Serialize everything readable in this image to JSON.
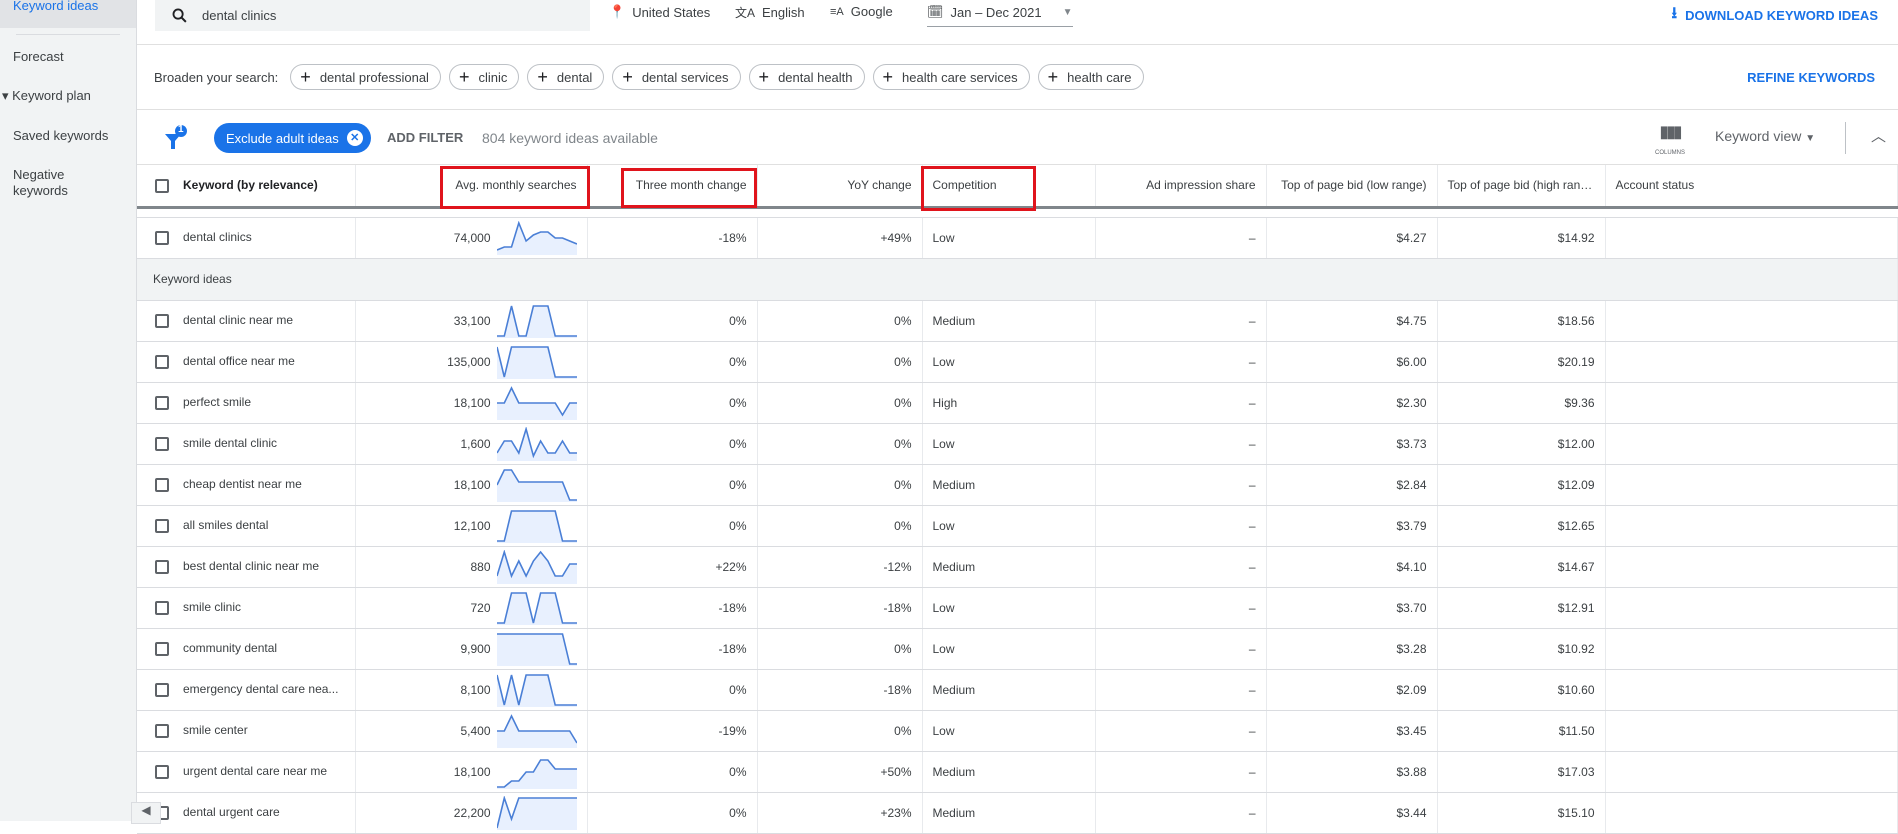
{
  "sidebar": {
    "items": [
      {
        "label": "Keyword ideas",
        "active": true
      },
      {
        "label": "Forecast"
      },
      {
        "label": "▾ Keyword plan"
      },
      {
        "label": "Saved keywords"
      },
      {
        "label": "Negative keywords"
      }
    ]
  },
  "topbar": {
    "search_value": "dental clinics",
    "location": "United States",
    "language": "English",
    "network": "Google",
    "date_range": "Jan – Dec 2021",
    "download_label": "DOWNLOAD KEYWORD IDEAS"
  },
  "broaden": {
    "label": "Broaden your search:",
    "chips": [
      "dental professional",
      "clinic",
      "dental",
      "dental services",
      "dental health",
      "health care services",
      "health care"
    ],
    "refine_label": "REFINE KEYWORDS"
  },
  "filters": {
    "badge_count": "1",
    "active_filter": "Exclude adult ideas",
    "add_filter_label": "ADD FILTER",
    "ideas_count": "804 keyword ideas available",
    "columns_label": "COLUMNS",
    "view_label": "Keyword view"
  },
  "table": {
    "columns": [
      "Keyword (by relevance)",
      "Avg. monthly searches",
      "Three month change",
      "YoY change",
      "Competition",
      "Ad impression share",
      "Top of page bid (low range)",
      "Top of page bid (high range)",
      "Account status"
    ],
    "highlight_color": "#e0141c",
    "sparkline_color": "#4a7fd6",
    "searched": [
      {
        "keyword": "dental clinics",
        "searches": "74,000",
        "three_month": "-18%",
        "yoy": "+49%",
        "competition": "Low",
        "impression": "–",
        "low_bid": "$4.27",
        "high_bid": "$14.92",
        "trend": [
          1,
          2,
          2,
          10,
          4,
          6,
          7,
          7,
          5,
          5,
          4,
          3
        ]
      }
    ],
    "group_label": "Keyword ideas",
    "rows": [
      {
        "keyword": "dental clinic near me",
        "searches": "33,100",
        "three_month": "0%",
        "yoy": "0%",
        "competition": "Medium",
        "impression": "–",
        "low_bid": "$4.75",
        "high_bid": "$18.56",
        "trend": [
          0,
          0,
          10,
          0,
          0,
          10,
          10,
          10,
          0,
          0,
          0,
          0
        ]
      },
      {
        "keyword": "dental office near me",
        "searches": "135,000",
        "three_month": "0%",
        "yoy": "0%",
        "competition": "Low",
        "impression": "–",
        "low_bid": "$6.00",
        "high_bid": "$20.19",
        "trend": [
          10,
          0,
          10,
          10,
          10,
          10,
          10,
          10,
          0,
          0,
          0,
          0
        ]
      },
      {
        "keyword": "perfect smile",
        "searches": "18,100",
        "three_month": "0%",
        "yoy": "0%",
        "competition": "High",
        "impression": "–",
        "low_bid": "$2.30",
        "high_bid": "$9.36",
        "trend": [
          5,
          5,
          10,
          5,
          5,
          5,
          5,
          5,
          5,
          1,
          5,
          5
        ]
      },
      {
        "keyword": "smile dental clinic",
        "searches": "1,600",
        "three_month": "0%",
        "yoy": "0%",
        "competition": "Low",
        "impression": "–",
        "low_bid": "$3.73",
        "high_bid": "$12.00",
        "trend": [
          2,
          6,
          6,
          2,
          10,
          1,
          6,
          2,
          2,
          6,
          2,
          2
        ]
      },
      {
        "keyword": "cheap dentist near me",
        "searches": "18,100",
        "three_month": "0%",
        "yoy": "0%",
        "competition": "Medium",
        "impression": "–",
        "low_bid": "$2.84",
        "high_bid": "$12.09",
        "trend": [
          5,
          10,
          10,
          6,
          6,
          6,
          6,
          6,
          6,
          6,
          0,
          0
        ]
      },
      {
        "keyword": "all smiles dental",
        "searches": "12,100",
        "three_month": "0%",
        "yoy": "0%",
        "competition": "Low",
        "impression": "–",
        "low_bid": "$3.79",
        "high_bid": "$12.65",
        "trend": [
          0,
          0,
          10,
          10,
          10,
          10,
          10,
          10,
          10,
          0,
          0,
          0
        ]
      },
      {
        "keyword": "best dental clinic near me",
        "searches": "880",
        "three_month": "+22%",
        "yoy": "-12%",
        "competition": "Medium",
        "impression": "–",
        "low_bid": "$4.10",
        "high_bid": "$14.67",
        "trend": [
          2,
          10,
          2,
          7,
          2,
          7,
          10,
          7,
          2,
          2,
          6,
          6
        ]
      },
      {
        "keyword": "smile clinic",
        "searches": "720",
        "three_month": "-18%",
        "yoy": "-18%",
        "competition": "Low",
        "impression": "–",
        "low_bid": "$3.70",
        "high_bid": "$12.91",
        "trend": [
          0,
          0,
          10,
          10,
          10,
          0,
          10,
          10,
          10,
          0,
          0,
          0
        ]
      },
      {
        "keyword": "community dental",
        "searches": "9,900",
        "three_month": "-18%",
        "yoy": "0%",
        "competition": "Low",
        "impression": "–",
        "low_bid": "$3.28",
        "high_bid": "$10.92",
        "trend": [
          10,
          10,
          10,
          10,
          10,
          10,
          10,
          10,
          10,
          10,
          0,
          0
        ]
      },
      {
        "keyword": "emergency dental care nea...",
        "searches": "8,100",
        "three_month": "0%",
        "yoy": "-18%",
        "competition": "Medium",
        "impression": "–",
        "low_bid": "$2.09",
        "high_bid": "$10.60",
        "trend": [
          10,
          0,
          10,
          0,
          10,
          10,
          10,
          10,
          0,
          0,
          0,
          0
        ]
      },
      {
        "keyword": "smile center",
        "searches": "5,400",
        "three_month": "-19%",
        "yoy": "0%",
        "competition": "Low",
        "impression": "–",
        "low_bid": "$3.45",
        "high_bid": "$11.50",
        "trend": [
          5,
          5,
          10,
          5,
          5,
          5,
          5,
          5,
          5,
          5,
          5,
          1
        ]
      },
      {
        "keyword": "urgent dental care near me",
        "searches": "18,100",
        "three_month": "0%",
        "yoy": "+50%",
        "competition": "Medium",
        "impression": "–",
        "low_bid": "$3.88",
        "high_bid": "$17.03",
        "trend": [
          0,
          0,
          2,
          2,
          5,
          5,
          9,
          9,
          6,
          6,
          6,
          6
        ]
      },
      {
        "keyword": "dental urgent care",
        "searches": "22,200",
        "three_month": "0%",
        "yoy": "+23%",
        "competition": "Medium",
        "impression": "–",
        "low_bid": "$3.44",
        "high_bid": "$15.10",
        "trend": [
          0,
          10,
          3,
          10,
          10,
          10,
          10,
          10,
          10,
          10,
          10,
          10
        ]
      }
    ]
  }
}
